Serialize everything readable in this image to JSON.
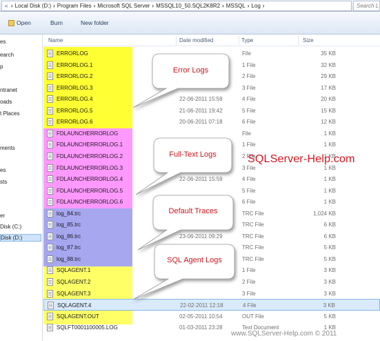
{
  "address_bar": {
    "crumbs": [
      "Local Disk (D:)",
      "Program Files",
      "Microsoft SQL Server",
      "MSSQL10_50.SQL2K8R2",
      "MSSQL",
      "Log"
    ],
    "search_placeholder": "Search L"
  },
  "command_bar": {
    "open_label": "Open",
    "burn_label": "Burn",
    "new_folder_label": "New folder"
  },
  "nav_pane": {
    "items": [
      {
        "label": "es",
        "y": 0
      },
      {
        "label": "earch",
        "y": 1
      },
      {
        "label": "p",
        "y": 2
      },
      {
        "label": "ntranet",
        "y": 3
      },
      {
        "label": "oads",
        "y": 4
      },
      {
        "label": "t Places",
        "y": 5
      },
      {
        "label": "ments",
        "y": 6
      },
      {
        "label": "es",
        "y": 7
      },
      {
        "label": "sts",
        "y": 8
      },
      {
        "label": "er",
        "y": 9
      },
      {
        "label": "Disk (C:)",
        "y": 10
      },
      {
        "label": "Disk (D:)",
        "y": 11,
        "selected": true
      }
    ]
  },
  "columns": {
    "name": "Name",
    "date": "Date modified",
    "type": "Type",
    "size": "Size"
  },
  "files": [
    {
      "name": "ERRORLOG",
      "date": "",
      "type": "File",
      "size": "35 KB"
    },
    {
      "name": "ERRORLOG.1",
      "date": "",
      "type": "1 File",
      "size": "32 KB"
    },
    {
      "name": "ERRORLOG.2",
      "date": "",
      "type": "2 File",
      "size": "29 KB"
    },
    {
      "name": "ERRORLOG.3",
      "date": "",
      "type": "3 File",
      "size": "17 KB"
    },
    {
      "name": "ERRORLOG.4",
      "date": "22-06-2011 15:59",
      "type": "4 File",
      "size": "20 KB"
    },
    {
      "name": "ERRORLOG.5",
      "date": "21-06-2011 19:42",
      "type": "5 File",
      "size": "15 KB"
    },
    {
      "name": "ERRORLOG.6",
      "date": "20-06-2011 07:18",
      "type": "6 File",
      "size": "12 KB"
    },
    {
      "name": "FDLAUNCHERRORLOG",
      "date": "",
      "type": "File",
      "size": "1 KB"
    },
    {
      "name": "FDLAUNCHERRORLOG.1",
      "date": "",
      "type": "1 File",
      "size": "1 KB"
    },
    {
      "name": "FDLAUNCHERRORLOG.2",
      "date": "",
      "type": "2 File",
      "size": "1 KB"
    },
    {
      "name": "FDLAUNCHERRORLOG.3",
      "date": "",
      "type": "3 File",
      "size": "1 KB"
    },
    {
      "name": "FDLAUNCHERRORLOG.4",
      "date": "22-06-2011 15:59",
      "type": "4 File",
      "size": "1 KB"
    },
    {
      "name": "FDLAUNCHERRORLOG.5",
      "date": "",
      "type": "5 File",
      "size": "1 KB"
    },
    {
      "name": "FDLAUNCHERRORLOG.6",
      "date": "",
      "type": "6 File",
      "size": "1 KB"
    },
    {
      "name": "log_84.trc",
      "date": "",
      "type": "TRC File",
      "size": "1,024 KB"
    },
    {
      "name": "log_85.trc",
      "date": "",
      "type": "TRC File",
      "size": "6 KB"
    },
    {
      "name": "log_86.trc",
      "date": "23-06-2011 09:29",
      "type": "TRC File",
      "size": "6 KB"
    },
    {
      "name": "log_87.trc",
      "date": "",
      "type": "TRC File",
      "size": "5 KB"
    },
    {
      "name": "log_88.trc",
      "date": "",
      "type": "TRC File",
      "size": "5 KB"
    },
    {
      "name": "SQLAGENT.1",
      "date": "",
      "type": "1 File",
      "size": "3 KB"
    },
    {
      "name": "SQLAGENT.2",
      "date": "",
      "type": "2 File",
      "size": "3 KB"
    },
    {
      "name": "SQLAGENT.3",
      "date": "",
      "type": "3 File",
      "size": "3 KB"
    },
    {
      "name": "SQLAGENT.4",
      "date": "22-02-2011 12:18",
      "type": "4 File",
      "size": "3 KB",
      "selected": true
    },
    {
      "name": "SQLAGENT.OUT",
      "date": "02-05-2011 10:54",
      "type": "OUT File",
      "size": "5 KB"
    },
    {
      "name": "SQLFT0001100005.LOG",
      "date": "01-03-2011 23:28",
      "type": "Text Document",
      "size": "1 KB"
    }
  ],
  "callouts": {
    "error_logs": "Error Logs",
    "fulltext_logs": "Full-Text Logs",
    "default_traces": "Default Traces",
    "sql_agent_logs": "SQL Agent Logs"
  },
  "brand": "SQLServer-Help.com",
  "footer": "www.SQLServer-Help.com © 2011",
  "colors": {
    "error_band": "#ffff33",
    "fulltext_band": "#ff99ff",
    "traces_band": "#a7a7f0",
    "agent_band": "#ffff66",
    "callout_text": "#c8161d"
  }
}
